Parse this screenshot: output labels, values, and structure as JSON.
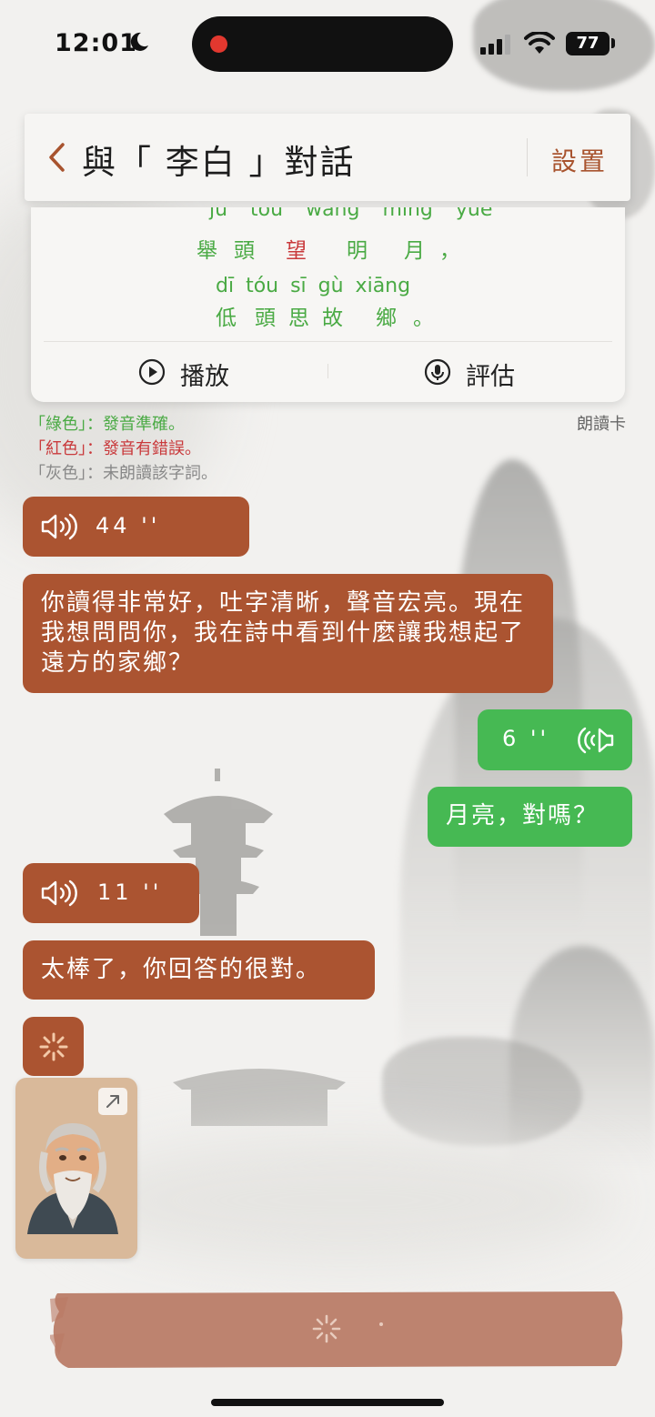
{
  "status_bar": {
    "time": "12:01",
    "battery": "77"
  },
  "header": {
    "title": "與「 李白 」對話",
    "settings": "設置"
  },
  "reading_card": {
    "cut_pinyin": "ju tou wang ming yue",
    "line1_chars": [
      "舉",
      "頭",
      "望",
      "明",
      "月",
      "，"
    ],
    "line2_pinyin": "dī  tóu  sī  gù  xiāng",
    "line2_chars": [
      "低",
      "頭",
      "思",
      "故",
      "鄉",
      "。"
    ],
    "play_label": "播放",
    "evaluate_label": "評估",
    "tag": "朗讀卡"
  },
  "legend": [
    {
      "text": "「綠色」：發音準確。",
      "color": "#4aaa44"
    },
    {
      "text": "「紅色」：發音有錯誤。",
      "color": "#c93a3c"
    },
    {
      "text": "「灰色」：未朗讀該字詞。",
      "color": "#888888"
    }
  ],
  "messages": {
    "voice1": "44 ''",
    "text1": "你讀得非常好，吐字清晰，聲音宏亮。現在我想問問你，我在詩中看到什麼讓我想起了遠方的家鄉？",
    "voice2": "6 ''",
    "text2": "月亮，對嗎？",
    "voice3": "11 ''",
    "text3": "太棒了，你回答的很對。"
  },
  "colors": {
    "brown_bubble": "#ab5431",
    "green_bubble": "#46b953",
    "accent": "#a8532e"
  },
  "icons": [
    "moon-icon",
    "signal-icon",
    "wifi-icon",
    "back-chevron-icon",
    "play-circle-icon",
    "mic-icon",
    "speaker-icon",
    "loading-spinner-icon",
    "expand-icon"
  ]
}
